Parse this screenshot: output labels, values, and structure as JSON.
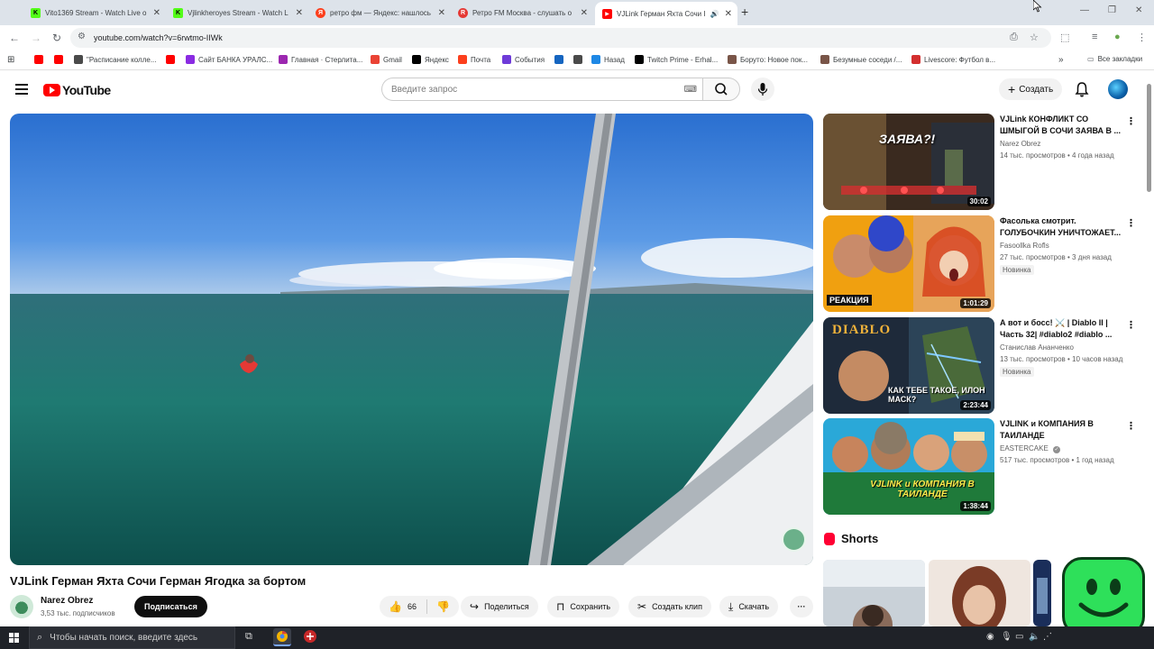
{
  "browser": {
    "tabs": [
      {
        "title": "Vito1369 Stream - Watch Live o",
        "favicon": "kick-icon",
        "color": "#53fc18"
      },
      {
        "title": "Vjlinkheroyes Stream - Watch L",
        "favicon": "kick-icon",
        "color": "#53fc18"
      },
      {
        "title": "ретро фм — Яндекс: нашлось",
        "favicon": "yandex-icon",
        "color": "#fc3f1d"
      },
      {
        "title": "Ретро FM Москва - слушать о",
        "favicon": "retrofm-icon",
        "color": "#e53935"
      },
      {
        "title": "VJLink Герман Яхта Сочи I",
        "favicon": "youtube-icon",
        "color": "#ff0000"
      }
    ],
    "new_tab": "+",
    "url": "youtube.com/watch?v=6rwtmo-IIWk",
    "bookmarks": [
      {
        "label": "",
        "color": "#ff0000"
      },
      {
        "label": "",
        "color": "#ff0000"
      },
      {
        "label": "\"Расписание колле...",
        "color": "#4a4a4a"
      },
      {
        "label": "",
        "color": "#ff0000"
      },
      {
        "label": "Сайт БАНКА УРАЛС...",
        "color": "#8a2be2"
      },
      {
        "label": "Главная · Стерлита...",
        "color": "#9c27b0"
      },
      {
        "label": "Gmail",
        "color": "#ea4335"
      },
      {
        "label": "Яндекс",
        "color": "#000000"
      },
      {
        "label": "Почта",
        "color": "#fc3f1d"
      },
      {
        "label": "События",
        "color": "#6e3bd8"
      },
      {
        "label": "",
        "color": "#1565c0"
      },
      {
        "label": "",
        "color": "#4a4a4a"
      },
      {
        "label": "Назад",
        "color": "#1e88e5"
      },
      {
        "label": "Twitch Prime - Erhal...",
        "color": "#000000"
      },
      {
        "label": "Боруто: Новое пок...",
        "color": "#795548"
      },
      {
        "label": "Безумные соседи /...",
        "color": "#795548"
      },
      {
        "label": "Livescore: Футбол в...",
        "color": "#d32f2f"
      }
    ],
    "all_bookmarks": "Все закладки"
  },
  "youtube": {
    "logo": "YouTube",
    "search_placeholder": "Введите запрос",
    "create_label": "Создать"
  },
  "video": {
    "title": "VJLink Герман Яхта Сочи Герман Ягодка за бортом",
    "channel": "Narez Obrez",
    "subscribers": "3,53 тыс. подписчиков",
    "subscribe_label": "Подписаться",
    "likes": "66",
    "share_label": "Поделиться",
    "save_label": "Сохранить",
    "clip_label": "Создать клип",
    "download_label": "Скачать"
  },
  "recommendations": [
    {
      "title": "VJLink КОНФЛИКТ СО ШМЫГОЙ В СОЧИ ЗАЯВА В ...",
      "channel": "Narez Obrez",
      "meta": "14 тыс. просмотров • 4 года назад",
      "badge": "",
      "duration": "30:02",
      "thumb_text": "ЗАЯВА?!"
    },
    {
      "title": "Фасолька смотрит. ГОЛУБОЧКИН УНИЧТОЖАЕТ...",
      "channel": "Fasoollka Rofls",
      "meta": "27 тыс. просмотров • 3 дня назад",
      "badge": "Новинка",
      "duration": "1:01:29",
      "thumb_text": "РЕАКЦИЯ"
    },
    {
      "title": "А вот и босс! ⚔️ | Diablo II | Часть 32| #diablo2 #diablo ...",
      "channel": "Станислав Ананченко",
      "meta": "13 тыс. просмотров • 10 часов назад",
      "badge": "Новинка",
      "duration": "2:23:44",
      "thumb_text": "КАК ТЕБЕ ТАКОЕ, ИЛОН МАСК?",
      "thumb_logo": "DIABLO"
    },
    {
      "title": "VJLINK и КОМПАНИЯ В ТАИЛАНДЕ",
      "channel": "EASTERCAKE",
      "meta": "517 тыс. просмотров • 1 год назад",
      "badge": "",
      "duration": "1:38:44",
      "thumb_text": "VJLINK и КОМПАНИЯ В ТАИЛАНДЕ"
    }
  ],
  "shorts_label": "Shorts",
  "taskbar": {
    "search_placeholder": "Чтобы начать поиск, введите здесь"
  }
}
